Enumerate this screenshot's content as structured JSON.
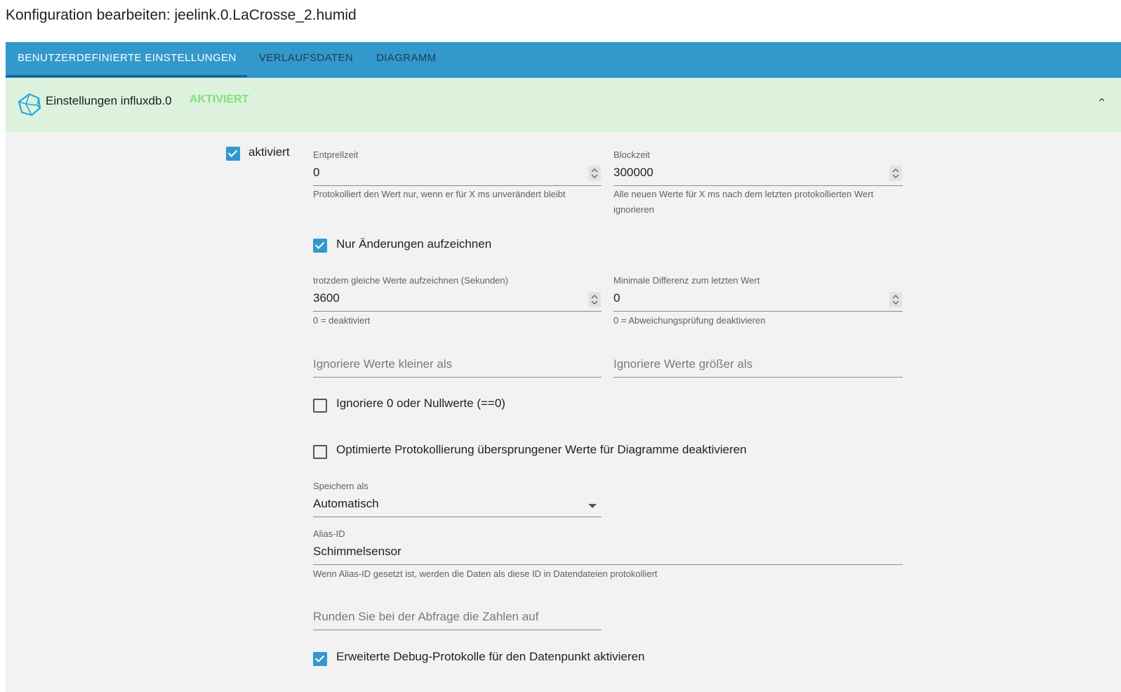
{
  "dialog": {
    "title": "Konfiguration bearbeiten: jeelink.0.LaCrosse_2.humid"
  },
  "tabs": [
    {
      "label": "BENUTZERDEFINIERTE EINSTELLUNGEN",
      "active": true
    },
    {
      "label": "VERLAUFSDATEN",
      "active": false
    },
    {
      "label": "DIAGRAMM",
      "active": false
    }
  ],
  "panel": {
    "title": "Einstellungen influxdb.0",
    "status": "AKTIVIERT",
    "icon": "influxdb-logo-icon"
  },
  "settings": {
    "enabled": {
      "label": "aktiviert",
      "checked": true
    },
    "debounce": {
      "label": "Entprellzeit",
      "value": "0",
      "help": "Protokolliert den Wert nur, wenn er für X ms unverändert bleibt"
    },
    "blocktime": {
      "label": "Blockzeit",
      "value": "300000",
      "help": "Alle neuen Werte für X ms nach dem letzten protokollierten Wert ignorieren"
    },
    "changes_only": {
      "label": "Nur Änderungen aufzeichnen",
      "checked": true
    },
    "changes_relog": {
      "label": "trotzdem gleiche Werte aufzeichnen (Sekunden)",
      "value": "3600",
      "help": "0 = deaktiviert"
    },
    "min_diff": {
      "label": "Minimale Differenz zum letzten Wert",
      "value": "0",
      "help": "0 = Abweichungsprüfung deaktivieren"
    },
    "ignore_below": {
      "placeholder": "Ignoriere Werte kleiner als"
    },
    "ignore_above": {
      "placeholder": "Ignoriere Werte größer als"
    },
    "ignore_zero": {
      "label": "Ignoriere 0 oder Nullwerte (==0)",
      "checked": false
    },
    "disable_skipped": {
      "label": "Optimierte Protokollierung übersprungener Werte für Diagramme deaktivieren",
      "checked": false
    },
    "store_as": {
      "label": "Speichern als",
      "value": "Automatisch"
    },
    "alias": {
      "label": "Alias-ID",
      "value": "Schimmelsensor",
      "help": "Wenn Alias-ID gesetzt ist, werden die Daten als diese ID in Datendateien protokolliert"
    },
    "round": {
      "placeholder": "Runden Sie bei der Abfrage die Zahlen auf"
    },
    "debug": {
      "label": "Erweiterte Debug-Protokolle für den Datenpunkt aktivieren",
      "checked": true
    }
  },
  "colors": {
    "accent": "#3399cc",
    "header_bg": "#dcf2dc",
    "status_green": "#7fe07f",
    "content_bg": "#f2f2f2"
  }
}
